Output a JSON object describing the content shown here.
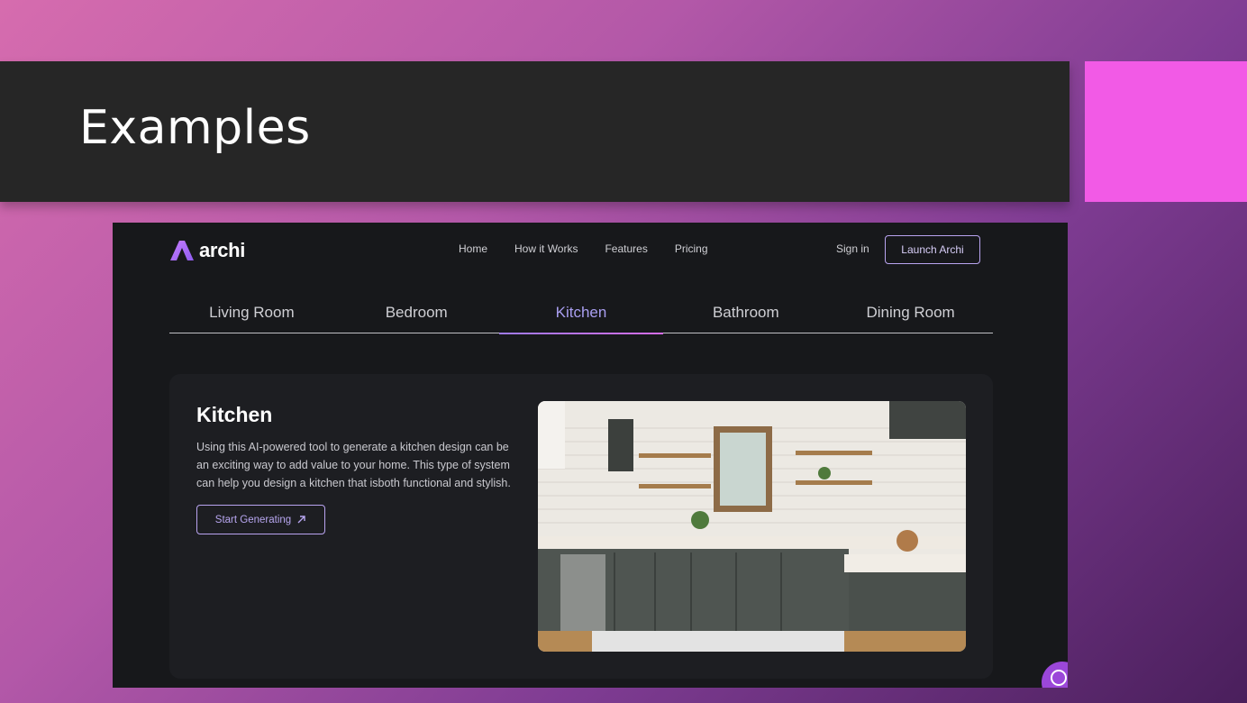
{
  "slide": {
    "title": "Examples"
  },
  "site": {
    "logo_text": "archi",
    "nav": [
      "Home",
      "How it Works",
      "Features",
      "Pricing"
    ],
    "signin_label": "Sign in",
    "launch_label": "Launch Archi"
  },
  "tabs": [
    {
      "label": "Living Room",
      "active": false
    },
    {
      "label": "Bedroom",
      "active": false
    },
    {
      "label": "Kitchen",
      "active": true
    },
    {
      "label": "Bathroom",
      "active": false
    },
    {
      "label": "Dining Room",
      "active": false
    }
  ],
  "card": {
    "heading": "Kitchen",
    "description": "Using this AI-powered tool to generate a kitchen design can be an exciting way to add value to your home. This type of system can help you design a kitchen that isboth functional and stylish.",
    "cta_label": "Start Generating"
  },
  "colors": {
    "accent_pink": "#f25ae6",
    "title_bar": "#262626",
    "site_bg": "#17181b",
    "card_bg": "#1d1e22",
    "active_tab": "#a99ef0",
    "chat_button": "#9b47d9"
  },
  "icons": [
    "archi-logo-icon",
    "arrow-up-right-icon",
    "chat-icon"
  ]
}
